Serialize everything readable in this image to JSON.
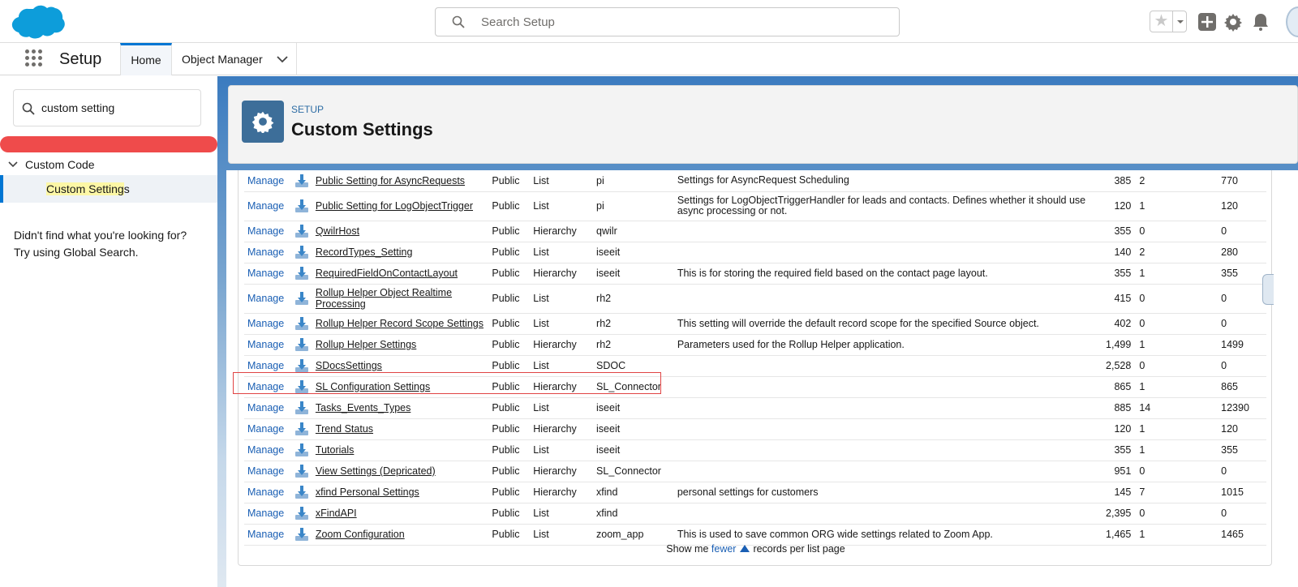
{
  "header": {
    "search_placeholder": "Search Setup"
  },
  "nav": {
    "app_name": "Setup",
    "tabs": [
      {
        "label": "Home"
      },
      {
        "label": "Object Manager"
      }
    ]
  },
  "sidebar": {
    "quick_find_value": "custom setting",
    "category": "Custom Code",
    "item_highlight": "Custom Setting",
    "item_rest": "s",
    "hint_line1": "Didn't find what you're looking for?",
    "hint_line2": "Try using Global Search."
  },
  "page": {
    "eyebrow": "SETUP",
    "title": "Custom Settings"
  },
  "table": {
    "action_label": "Manage",
    "rows": [
      {
        "label": "Public Setting for AsyncRequests",
        "visibility": "Public",
        "type": "List",
        "namespace": "pi",
        "description": "Settings for AsyncRequest Scheduling",
        "size": "385",
        "count": "2",
        "total": "770"
      },
      {
        "label": "Public Setting for LogObjectTrigger",
        "visibility": "Public",
        "type": "List",
        "namespace": "pi",
        "description": "Settings for LogObjectTriggerHandler for leads and contacts. Defines whether it should use async processing or not.",
        "size": "120",
        "count": "1",
        "total": "120"
      },
      {
        "label": "QwilrHost",
        "visibility": "Public",
        "type": "Hierarchy",
        "namespace": "qwilr",
        "description": "",
        "size": "355",
        "count": "0",
        "total": "0"
      },
      {
        "label": "RecordTypes_Setting",
        "visibility": "Public",
        "type": "List",
        "namespace": "iseeit",
        "description": "",
        "size": "140",
        "count": "2",
        "total": "280"
      },
      {
        "label": "RequiredFieldOnContactLayout",
        "visibility": "Public",
        "type": "Hierarchy",
        "namespace": "iseeit",
        "description": "This is for storing the required field based on the contact page layout.",
        "size": "355",
        "count": "1",
        "total": "355"
      },
      {
        "label": "Rollup Helper Object Realtime Processing",
        "visibility": "Public",
        "type": "List",
        "namespace": "rh2",
        "description": "",
        "size": "415",
        "count": "0",
        "total": "0"
      },
      {
        "label": "Rollup Helper Record Scope Settings",
        "visibility": "Public",
        "type": "List",
        "namespace": "rh2",
        "description": "This setting will override the default record scope for the specified Source object.",
        "size": "402",
        "count": "0",
        "total": "0"
      },
      {
        "label": "Rollup Helper Settings",
        "visibility": "Public",
        "type": "Hierarchy",
        "namespace": "rh2",
        "description": "Parameters used for the Rollup Helper application.",
        "size": "1,499",
        "count": "1",
        "total": "1499"
      },
      {
        "label": "SDocsSettings",
        "visibility": "Public",
        "type": "List",
        "namespace": "SDOC",
        "description": "",
        "size": "2,528",
        "count": "0",
        "total": "0"
      },
      {
        "label": "SL Configuration Settings",
        "visibility": "Public",
        "type": "Hierarchy",
        "namespace": "SL_Connector",
        "description": "",
        "size": "865",
        "count": "1",
        "total": "865"
      },
      {
        "label": "Tasks_Events_Types",
        "visibility": "Public",
        "type": "List",
        "namespace": "iseeit",
        "description": "",
        "size": "885",
        "count": "14",
        "total": "12390"
      },
      {
        "label": "Trend Status",
        "visibility": "Public",
        "type": "Hierarchy",
        "namespace": "iseeit",
        "description": "",
        "size": "120",
        "count": "1",
        "total": "120"
      },
      {
        "label": "Tutorials",
        "visibility": "Public",
        "type": "List",
        "namespace": "iseeit",
        "description": "",
        "size": "355",
        "count": "1",
        "total": "355"
      },
      {
        "label": "View Settings (Depricated)",
        "visibility": "Public",
        "type": "Hierarchy",
        "namespace": "SL_Connector",
        "description": "",
        "size": "951",
        "count": "0",
        "total": "0"
      },
      {
        "label": "xfind Personal Settings",
        "visibility": "Public",
        "type": "Hierarchy",
        "namespace": "xfind",
        "description": "personal settings for customers",
        "size": "145",
        "count": "7",
        "total": "1015"
      },
      {
        "label": "xFindAPI",
        "visibility": "Public",
        "type": "List",
        "namespace": "xfind",
        "description": "",
        "size": "2,395",
        "count": "0",
        "total": "0"
      },
      {
        "label": "Zoom Configuration",
        "visibility": "Public",
        "type": "List",
        "namespace": "zoom_app",
        "description": "This is used to save common ORG wide settings related to Zoom App.",
        "size": "1,465",
        "count": "1",
        "total": "1465"
      }
    ]
  },
  "pager": {
    "prefix": "Show me",
    "link": "fewer",
    "suffix": "records per list page"
  },
  "colors": {
    "brand": "#0176d3",
    "link": "#1a5fb4",
    "highlight_box": "#e04444",
    "alert_bar": "#ef4b4b"
  },
  "icons": [
    "salesforce-cloud-logo",
    "search-icon",
    "star-icon",
    "add-icon",
    "gear-icon",
    "bell-icon",
    "avatar",
    "app-launcher-icon",
    "chevron-down-icon",
    "download-icon"
  ]
}
